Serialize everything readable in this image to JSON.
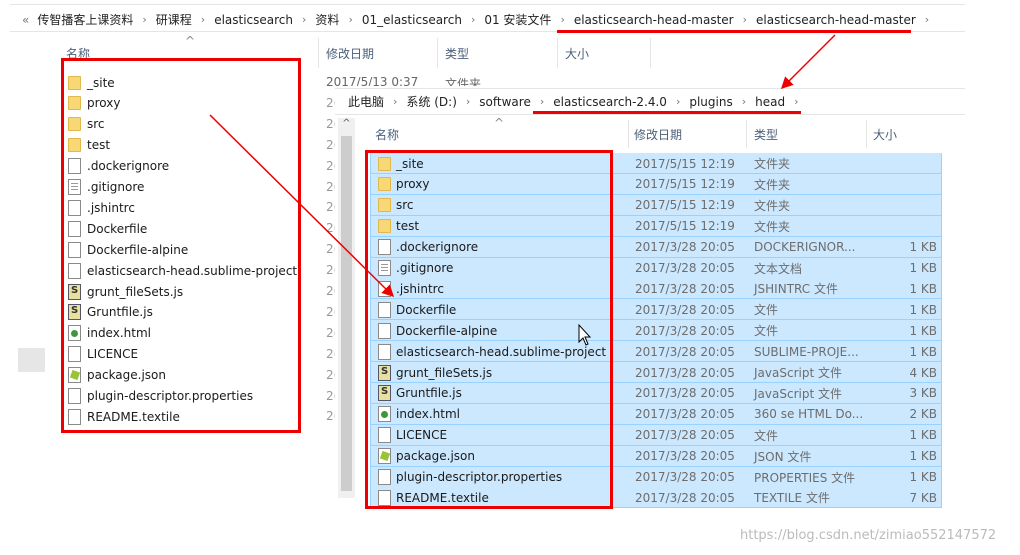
{
  "back_window": {
    "breadcrumb": [
      "传智播客上课资料",
      "研课程",
      "elasticsearch",
      "资料",
      "01_elasticsearch",
      "01 安装文件",
      "elasticsearch-head-master",
      "elasticsearch-head-master"
    ],
    "headers": {
      "name": "名称",
      "date": "修改日期",
      "type": "类型",
      "size": "大小"
    },
    "first_row_date": "2017/5/13 0:37",
    "first_row_type": "文件夹",
    "date_stub": "2("
  },
  "front_window": {
    "breadcrumb": [
      "此电脑",
      "系统 (D:)",
      "software",
      "elasticsearch-2.4.0",
      "plugins",
      "head"
    ],
    "headers": {
      "name": "名称",
      "date": "修改日期",
      "type": "类型",
      "size": "大小"
    }
  },
  "files": [
    {
      "name": "_site",
      "date": "2017/5/15 12:19",
      "type": "文件夹",
      "size": "",
      "icon": "folder"
    },
    {
      "name": "proxy",
      "date": "2017/5/15 12:19",
      "type": "文件夹",
      "size": "",
      "icon": "folder"
    },
    {
      "name": "src",
      "date": "2017/5/15 12:19",
      "type": "文件夹",
      "size": "",
      "icon": "folder"
    },
    {
      "name": "test",
      "date": "2017/5/15 12:19",
      "type": "文件夹",
      "size": "",
      "icon": "folder"
    },
    {
      "name": ".dockerignore",
      "date": "2017/3/28 20:05",
      "type": "DOCKERIGNOR...",
      "size": "1 KB",
      "icon": "file"
    },
    {
      "name": ".gitignore",
      "date": "2017/3/28 20:05",
      "type": "文本文档",
      "size": "1 KB",
      "icon": "text"
    },
    {
      "name": ".jshintrc",
      "date": "2017/3/28 20:05",
      "type": "JSHINTRC 文件",
      "size": "1 KB",
      "icon": "file"
    },
    {
      "name": "Dockerfile",
      "date": "2017/3/28 20:05",
      "type": "文件",
      "size": "1 KB",
      "icon": "file"
    },
    {
      "name": "Dockerfile-alpine",
      "date": "2017/3/28 20:05",
      "type": "文件",
      "size": "1 KB",
      "icon": "file"
    },
    {
      "name": "elasticsearch-head.sublime-project",
      "date": "2017/3/28 20:05",
      "type": "SUBLIME-PROJE...",
      "size": "1 KB",
      "icon": "file"
    },
    {
      "name": "grunt_fileSets.js",
      "date": "2017/3/28 20:05",
      "type": "JavaScript 文件",
      "size": "4 KB",
      "icon": "js"
    },
    {
      "name": "Gruntfile.js",
      "date": "2017/3/28 20:05",
      "type": "JavaScript 文件",
      "size": "3 KB",
      "icon": "js"
    },
    {
      "name": "index.html",
      "date": "2017/3/28 20:05",
      "type": "360 se HTML Do...",
      "size": "2 KB",
      "icon": "html"
    },
    {
      "name": "LICENCE",
      "date": "2017/3/28 20:05",
      "type": "文件",
      "size": "1 KB",
      "icon": "file"
    },
    {
      "name": "package.json",
      "date": "2017/3/28 20:05",
      "type": "JSON 文件",
      "size": "1 KB",
      "icon": "json"
    },
    {
      "name": "plugin-descriptor.properties",
      "date": "2017/3/28 20:05",
      "type": "PROPERTIES 文件",
      "size": "1 KB",
      "icon": "file"
    },
    {
      "name": "README.textile",
      "date": "2017/3/28 20:05",
      "type": "TEXTILE 文件",
      "size": "7 KB",
      "icon": "file"
    }
  ],
  "watermark": "https://blog.csdn.net/zimiao552147572"
}
